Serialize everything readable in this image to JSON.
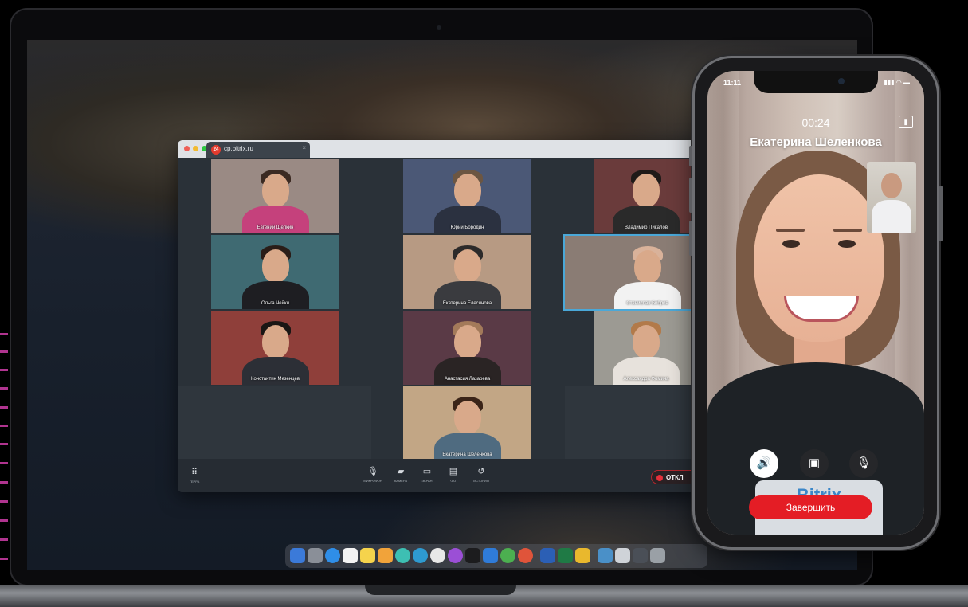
{
  "browser": {
    "tab_title": "cp.bitrix.ru",
    "tab_favicon": "24",
    "tab_close": "×"
  },
  "participants": [
    {
      "name": "Евгений Щелкин"
    },
    {
      "name": "Юрий Бородин"
    },
    {
      "name": "Владимир Пикалов"
    },
    {
      "name": "Ольга Чейки"
    },
    {
      "name": "Екатерина Елесинова"
    },
    {
      "name": "Станислав Бобров"
    },
    {
      "name": "Константин Мезенцев"
    },
    {
      "name": "Анастасия Лазарева"
    },
    {
      "name": "Александра Фомина"
    },
    {
      "name": "Екатерина Шеленкова"
    }
  ],
  "controls": {
    "grid_label": "ГЕРРА",
    "mic_label": "МИКРОФОН",
    "camera_label": "КАМЕРА",
    "screen_label": "ЭКРАН",
    "chat_label": "ЧАТ",
    "history_label": "ИСТОРИЯ",
    "end_label": "ОТКЛ"
  },
  "phone": {
    "status_time": "11:11",
    "status_icons": "▮▮▮ ◠ ▬",
    "call_timer": "00:24",
    "callee_name": "Екатерина Шеленкова",
    "end_button": "Завершить",
    "shirt_text": "Bitrix"
  },
  "colors": {
    "accent": "#b0348f",
    "end_call_red": "#e41d25",
    "selected_outline": "#4aa8d8"
  }
}
